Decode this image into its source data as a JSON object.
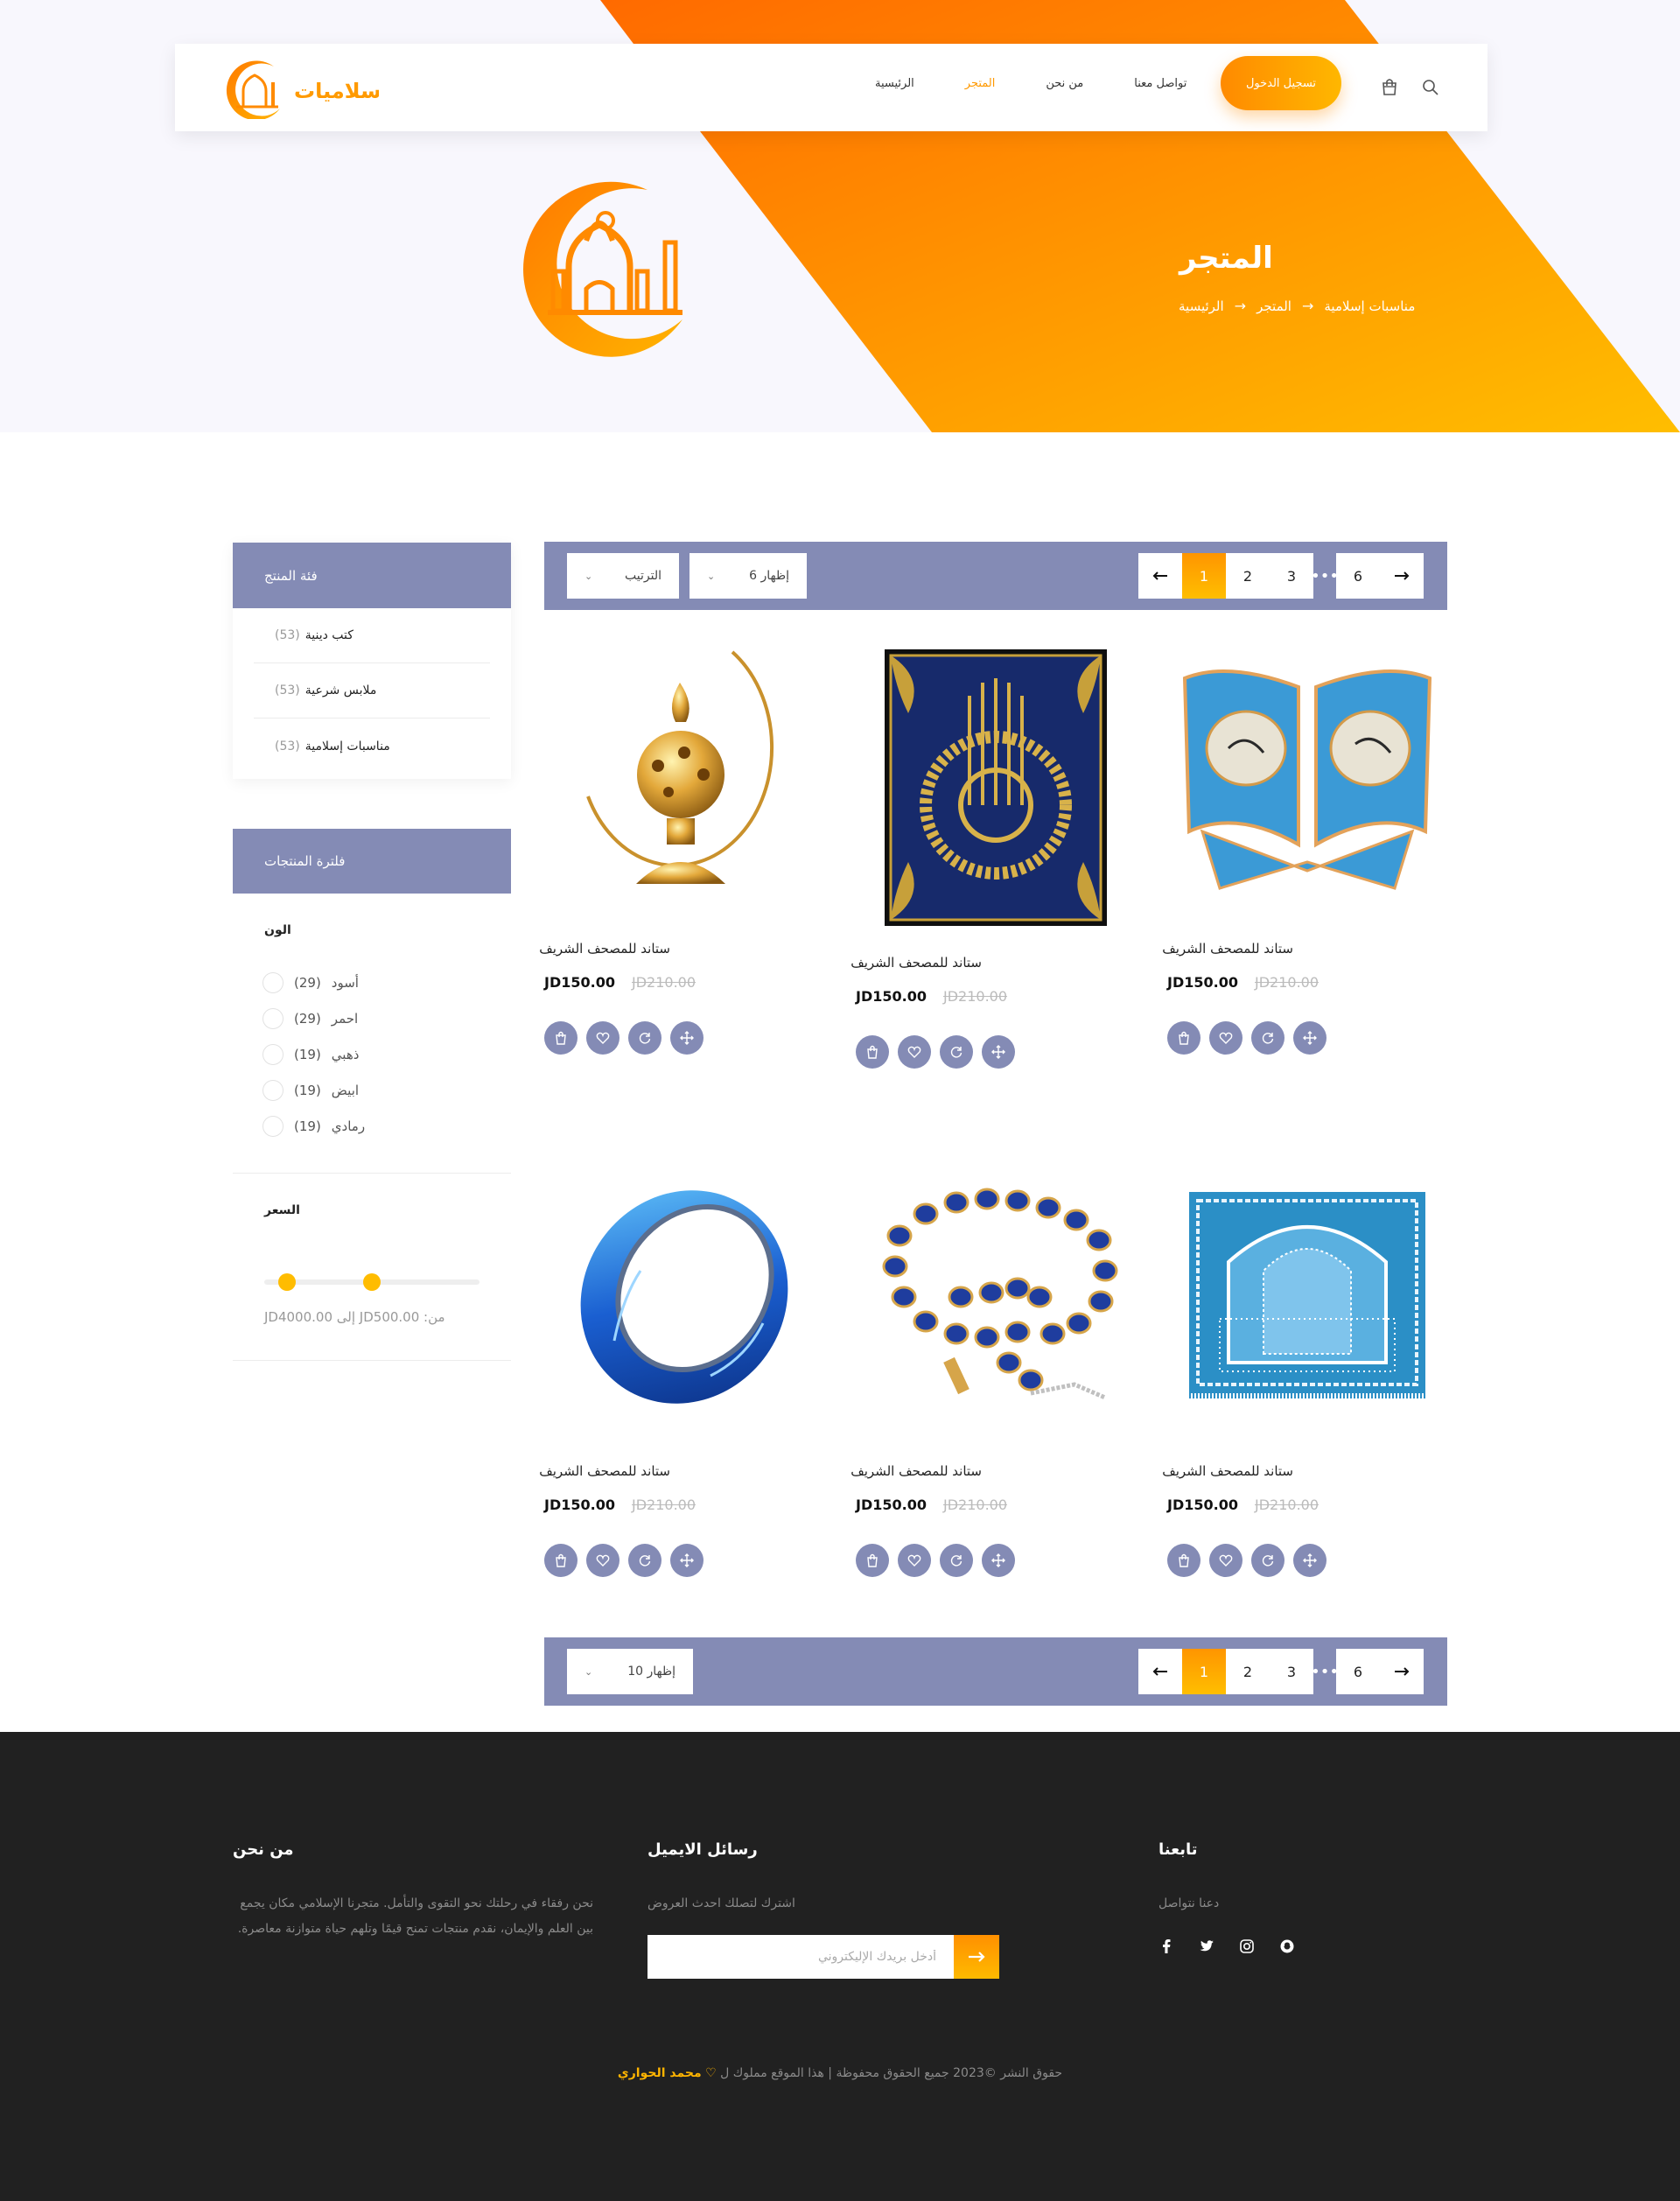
{
  "header": {
    "brand_text": "إسلاميات",
    "nav": [
      {
        "label": "الرئيسية",
        "active": false
      },
      {
        "label": "المتجر",
        "active": true
      },
      {
        "label": "من نحن",
        "active": false
      },
      {
        "label": "تواصل معنا",
        "active": false
      }
    ],
    "login_label": "تسجيل الدخول",
    "icons": [
      "cart-icon",
      "search-icon"
    ]
  },
  "hero": {
    "title": "المتجر",
    "breadcrumb": [
      "الرئيسية",
      "المتجر",
      "مناسبات إسلامية"
    ]
  },
  "sidebar": {
    "categories_title": "فئة المنتج",
    "categories": [
      {
        "label": "كتب دينية",
        "count": "(53)"
      },
      {
        "label": "ملابس شرعية",
        "count": "(53)"
      },
      {
        "label": "مناسبات إسلامية",
        "count": "(53)"
      }
    ],
    "filter_title": "فلترة المنتجات",
    "color_title": "الون",
    "colors": [
      {
        "label": "أسود",
        "count": "(29)"
      },
      {
        "label": "احمر",
        "count": "(29)"
      },
      {
        "label": "ذهبي",
        "count": "(19)"
      },
      {
        "label": "ابيض",
        "count": "(19)"
      },
      {
        "label": "رمادي",
        "count": "(19)"
      }
    ],
    "price_title": "السعر",
    "price_range_text": "من: JD500.00 إلى JD4000.00",
    "price_min": 500,
    "price_max": 4000
  },
  "toolbar_top": {
    "sort_label": "الترتيب",
    "show_label": "إظهار 6",
    "pages": [
      "1",
      "2",
      "3"
    ],
    "last_page": "6",
    "current_page": "1",
    "dots": "•••"
  },
  "toolbar_bottom": {
    "show_label": "إظهار 10",
    "pages": [
      "1",
      "2",
      "3"
    ],
    "last_page": "6",
    "current_page": "1",
    "dots": "•••"
  },
  "products": [
    {
      "name": "ستاند للمصحف الشريف",
      "price": "JD150.00",
      "old_price": "JD210.00",
      "image": "incense-burner"
    },
    {
      "name": "ستاند للمصحف الشريف",
      "price": "JD150.00",
      "old_price": "JD210.00",
      "image": "calligraphy-frame"
    },
    {
      "name": "ستاند للمصحف الشريف",
      "price": "JD150.00",
      "old_price": "JD210.00",
      "image": "quran-stand"
    },
    {
      "name": "ستاند للمصحف الشريف",
      "price": "JD150.00",
      "old_price": "JD210.00",
      "image": "blue-ring"
    },
    {
      "name": "ستاند للمصحف الشريف",
      "price": "JD150.00",
      "old_price": "JD210.00",
      "image": "prayer-beads"
    },
    {
      "name": "ستاند للمصحف الشريف",
      "price": "JD150.00",
      "old_price": "JD210.00",
      "image": "prayer-rug"
    }
  ],
  "product_actions": [
    "bag-icon",
    "heart-icon",
    "refresh-icon",
    "move-icon"
  ],
  "footer": {
    "about_title": "من نحن",
    "about_text": "نحن رفقاء في رحلتك نحو التقوى والتأمل. متجرنا الإسلامي مكان يجمع بين العلم والإيمان، نقدم منتجات تمنح قيمًا وتلهم حياة متوازنة معاصرة.",
    "newsletter_title": "رسائل الايميل",
    "newsletter_text": "اشترك لتصلك احدث العروض",
    "newsletter_placeholder": "أدخل بريدك الإليكتروني",
    "follow_title": "تابعنا",
    "follow_text": "دعنا نتواصل",
    "socials": [
      "facebook-icon",
      "twitter-icon",
      "instagram-icon",
      "snapchat-icon"
    ],
    "copyright_text": "حقوق النشر ©2023 جميع الحقوق محفوظة | هذا الموقع مملوك ل",
    "copyright_author": "محمد الحواري"
  },
  "colors": {
    "accent": "#ff9900",
    "accent_light": "#ffbc00",
    "panel": "#848bb5",
    "footer_bg": "#212121"
  }
}
